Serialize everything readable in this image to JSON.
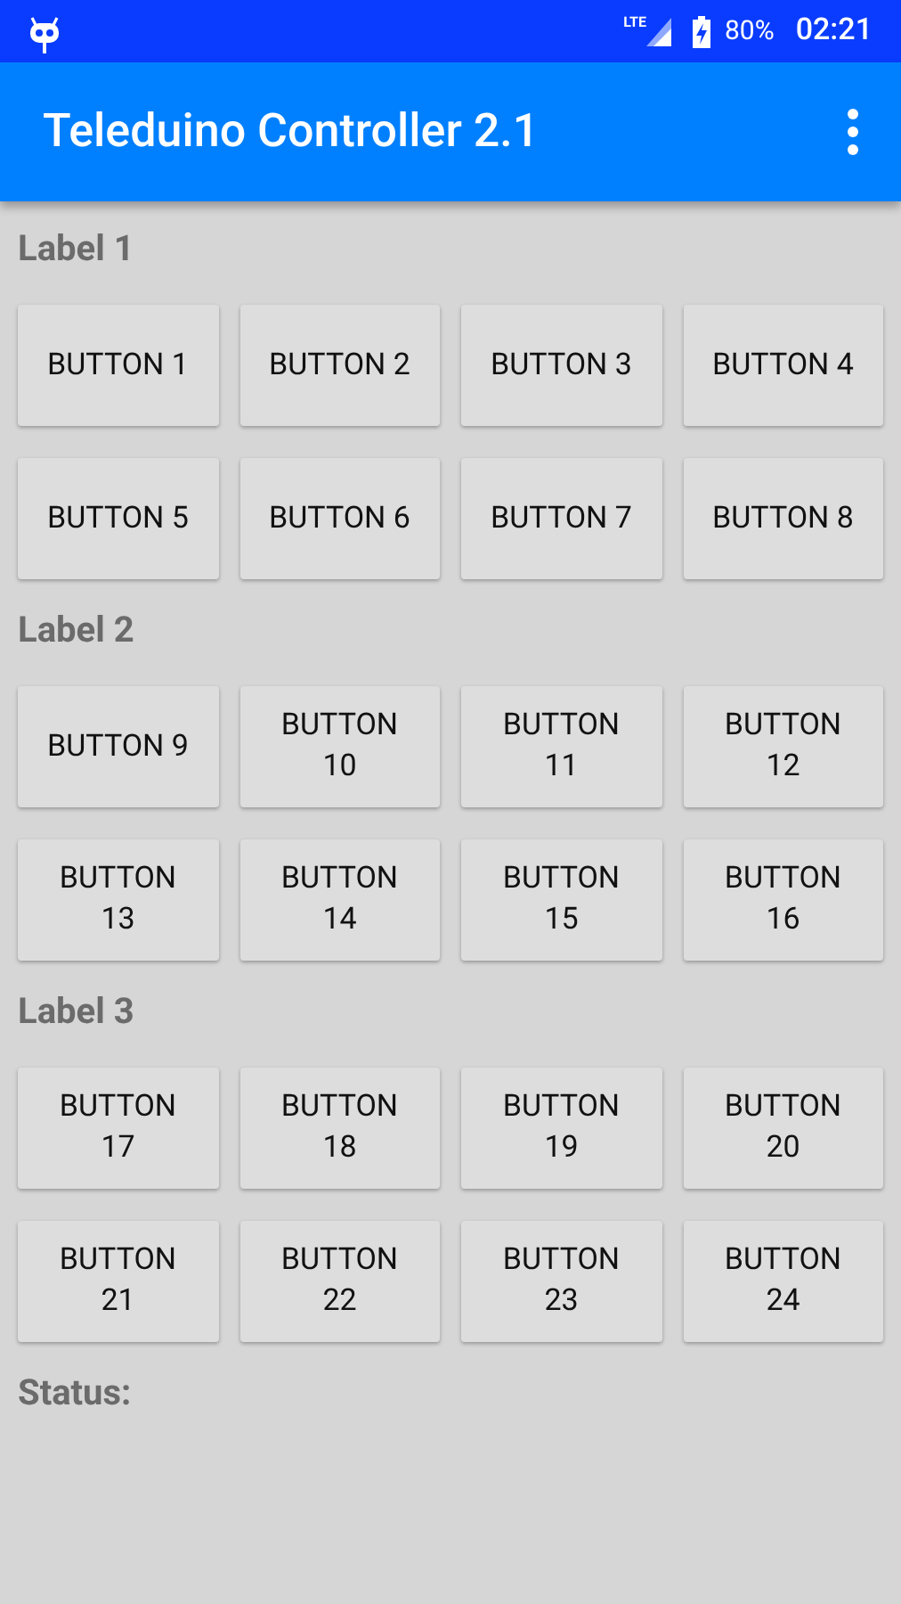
{
  "status_bar": {
    "network": "LTE",
    "battery": "80%",
    "time": "02:21"
  },
  "app_bar": {
    "title": "Teleduino Controller 2.1"
  },
  "sections": [
    {
      "label": "Label 1",
      "buttons": [
        "BUTTON 1",
        "BUTTON 2",
        "BUTTON 3",
        "BUTTON 4",
        "BUTTON 5",
        "BUTTON 6",
        "BUTTON 7",
        "BUTTON 8"
      ]
    },
    {
      "label": "Label 2",
      "buttons": [
        "BUTTON 9",
        "BUTTON 10",
        "BUTTON 11",
        "BUTTON 12",
        "BUTTON 13",
        "BUTTON 14",
        "BUTTON 15",
        "BUTTON 16"
      ]
    },
    {
      "label": "Label 3",
      "buttons": [
        "BUTTON 17",
        "BUTTON 18",
        "BUTTON 19",
        "BUTTON 20",
        "BUTTON 21",
        "BUTTON 22",
        "BUTTON 23",
        "BUTTON 24"
      ]
    }
  ],
  "status": {
    "label": "Status:"
  }
}
